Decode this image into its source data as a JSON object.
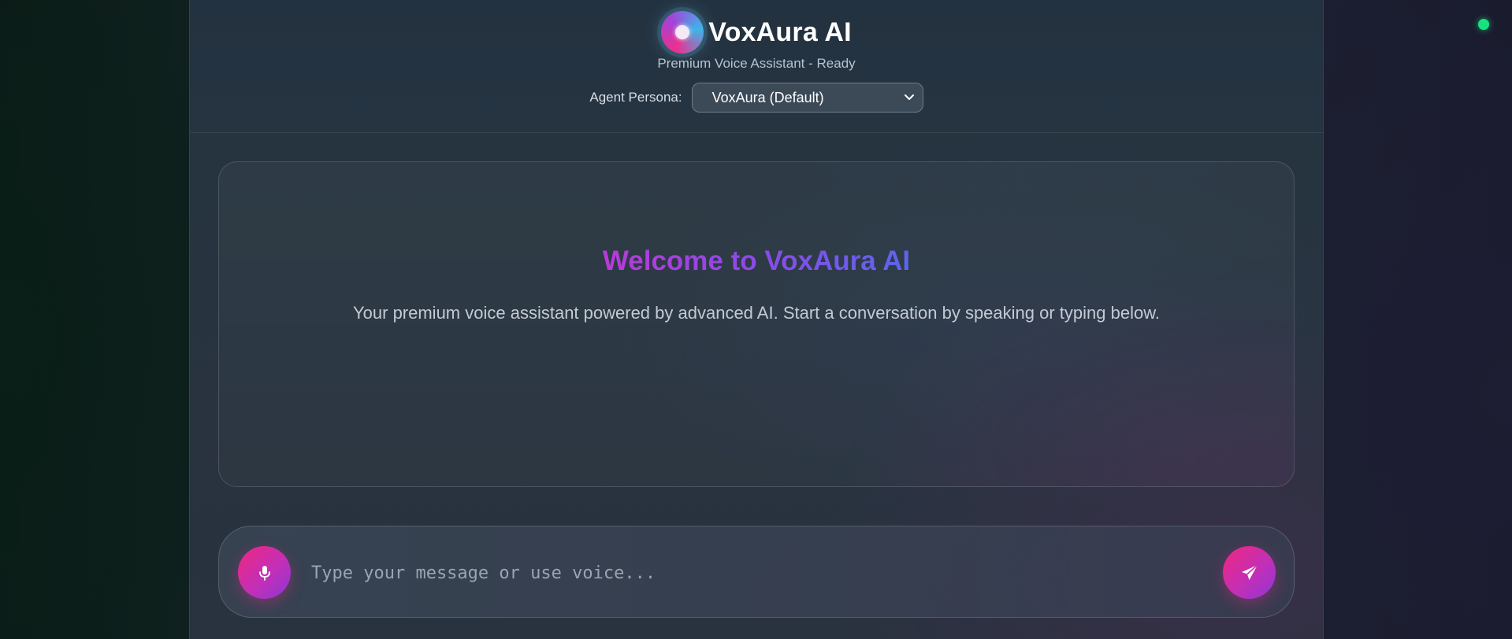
{
  "app": {
    "title": "VoxAura AI",
    "status_text": "Premium Voice Assistant - Ready",
    "logo_icon": "orb-logo-icon",
    "connection_status_color": "#19e27c"
  },
  "persona": {
    "label": "Agent Persona:",
    "selected": "VoxAura (Default)",
    "icon": "chevron-down-icon"
  },
  "welcome": {
    "title": "Welcome to VoxAura AI",
    "message": "Your premium voice assistant powered by advanced AI. Start a conversation by speaking or typing below.",
    "gradient_colors": [
      "#b93ad8",
      "#8b4ae8",
      "#5c66ea"
    ]
  },
  "composer": {
    "placeholder": "Type your message or use voice...",
    "value": "",
    "mic_icon": "microphone-icon",
    "send_icon": "paper-plane-icon",
    "accent_colors": [
      "#f0277e",
      "#c32fb6",
      "#8e36d6"
    ]
  }
}
